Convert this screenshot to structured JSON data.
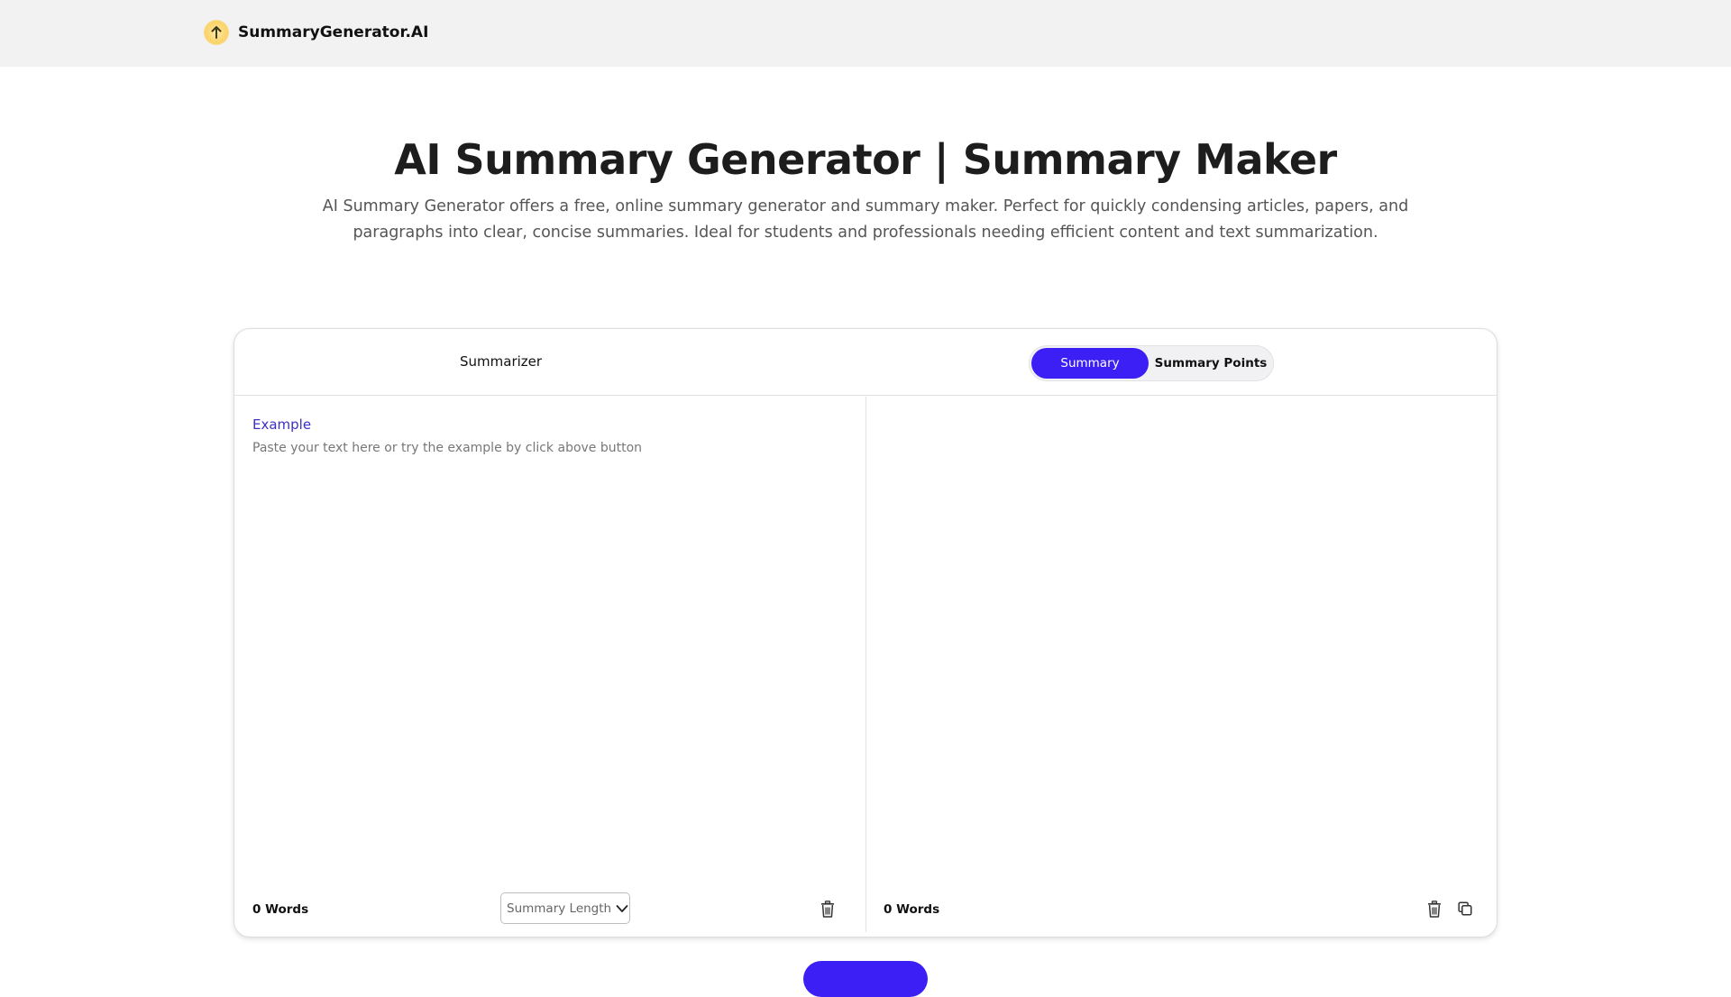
{
  "header": {
    "brand": "SummaryGenerator.AI",
    "logo_icon": "arrow-up-icon"
  },
  "hero": {
    "title": "AI Summary Generator | Summary Maker",
    "description": "AI Summary Generator offers a free, online summary generator and summary maker. Perfect for quickly condensing articles, papers, and paragraphs into clear, concise summaries. Ideal for students and professionals needing efficient content and text summarization."
  },
  "tool": {
    "title": "Summarizer",
    "modes": [
      {
        "label": "Summary",
        "active": true
      },
      {
        "label": "Summary Points",
        "active": false
      }
    ],
    "input": {
      "example_label": "Example",
      "placeholder": "Paste your text here or try the example by click above button",
      "value": "",
      "word_count": "0 Words",
      "length_select": "Summary Length"
    },
    "output": {
      "word_count": "0 Words"
    }
  },
  "colors": {
    "accent": "#3b1ff5",
    "link": "#3d2fc8",
    "header_bg": "#f2f2f2"
  },
  "primary_action": {
    "label": ""
  }
}
